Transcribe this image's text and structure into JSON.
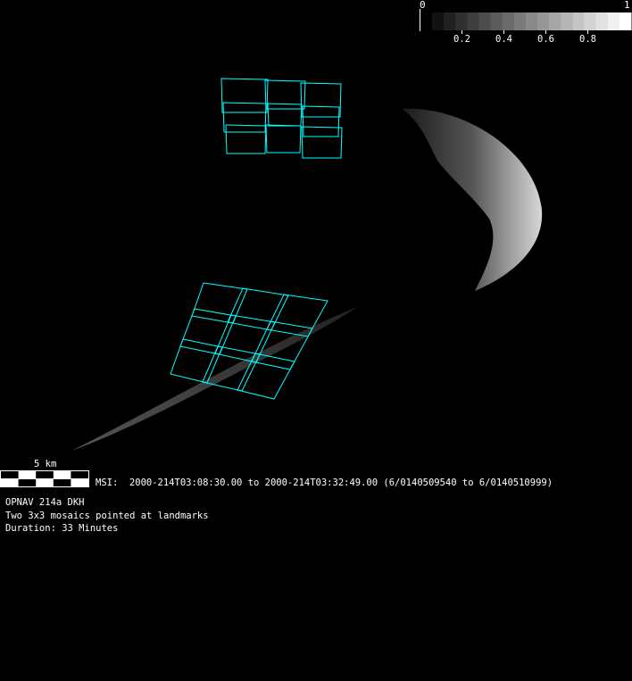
{
  "colorbar": {
    "min_label": "0",
    "max_label": "1",
    "tick_labels": [
      "0.2",
      "0.4",
      "0.6",
      "0.8"
    ],
    "steps": 17
  },
  "scale_bar": {
    "label": "5 km",
    "segments": 5
  },
  "msi_line": "MSI:  2000-214T03:08:30.00 to 2000-214T03:32:49.00 (6/0140509540 to 6/0140510999)",
  "info": {
    "line1": "OPNAV 214a DKH",
    "line2": "Two 3x3 mosaics pointed at landmarks",
    "line3": "Duration: 33 Minutes"
  },
  "colors": {
    "footprint": "#00ffff",
    "background": "#000000"
  }
}
